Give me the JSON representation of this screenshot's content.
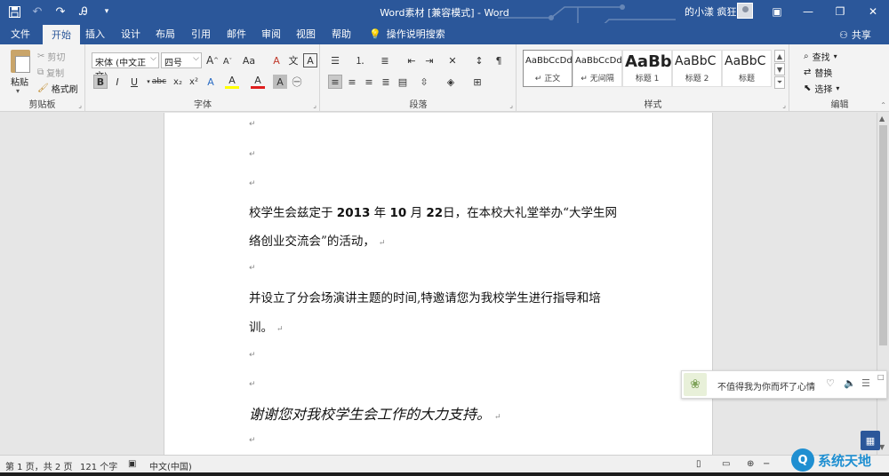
{
  "titlebar": {
    "title": "Word素材 [兼容模式] - Word",
    "user": "的小漾 疯狂",
    "qat": [
      "save-icon",
      "undo-icon",
      "redo-icon",
      "format-painter-icon",
      "customize-icon"
    ]
  },
  "tabs": [
    "文件",
    "开始",
    "插入",
    "设计",
    "布局",
    "引用",
    "邮件",
    "审阅",
    "视图",
    "帮助"
  ],
  "active_tab": "开始",
  "tell_me": "操作说明搜索",
  "share": "共享",
  "clipboard": {
    "paste": "粘贴",
    "cut": "剪切",
    "copy": "复制",
    "format_painter": "格式刷",
    "label": "剪贴板"
  },
  "font": {
    "name": "宋体 (中文正文)",
    "size": "四号",
    "label": "字体",
    "buttons": [
      "B",
      "I",
      "U",
      "abc",
      "x₂",
      "x²",
      "A",
      "A",
      "A",
      "A"
    ],
    "grow": "A",
    "shrink": "A",
    "case": "Aa",
    "clear": "A",
    "wen": "文",
    "border_char": "A"
  },
  "paragraph": {
    "label": "段落"
  },
  "styles": {
    "label": "样式",
    "items": [
      {
        "preview": "AaBbCcDdI",
        "name": "↵ 正文"
      },
      {
        "preview": "AaBbCcDdI",
        "name": "↵ 无间隔"
      },
      {
        "preview": "AaBb",
        "name": "标题 1"
      },
      {
        "preview": "AaBbC",
        "name": "标题 2"
      },
      {
        "preview": "AaBbC",
        "name": "标题"
      }
    ]
  },
  "editing": {
    "label": "编辑",
    "find": "查找",
    "replace": "替换",
    "select": "选择"
  },
  "document": {
    "mark": "↵",
    "p1_a": "校学生会兹定于",
    "p1_year": "2013",
    "p1_b": "年",
    "p1_month": "10",
    "p1_c": "月",
    "p1_day": "22",
    "p1_d": "日，在本校大礼堂举办“大学生网",
    "p1_line2": "络创业交流会”的活动，",
    "p2_line1": "并设立了分会场演讲主题的时间,特邀请您为我校学生进行指导和培",
    "p2_line2": "训。",
    "p3": "谢谢您对我校学生会工作的大力支持。"
  },
  "music_popup": {
    "song": "不值得我为你而坏了心情"
  },
  "statusbar": {
    "page": "第 1 页，共 2 页",
    "words": "121 个字",
    "language": "中文(中国)"
  },
  "watermark": {
    "badge": "Q",
    "text": "系统天地"
  },
  "colors": {
    "brand": "#2b579a",
    "font_highlight": "#ffff00",
    "font_color": "#e01e1e"
  }
}
